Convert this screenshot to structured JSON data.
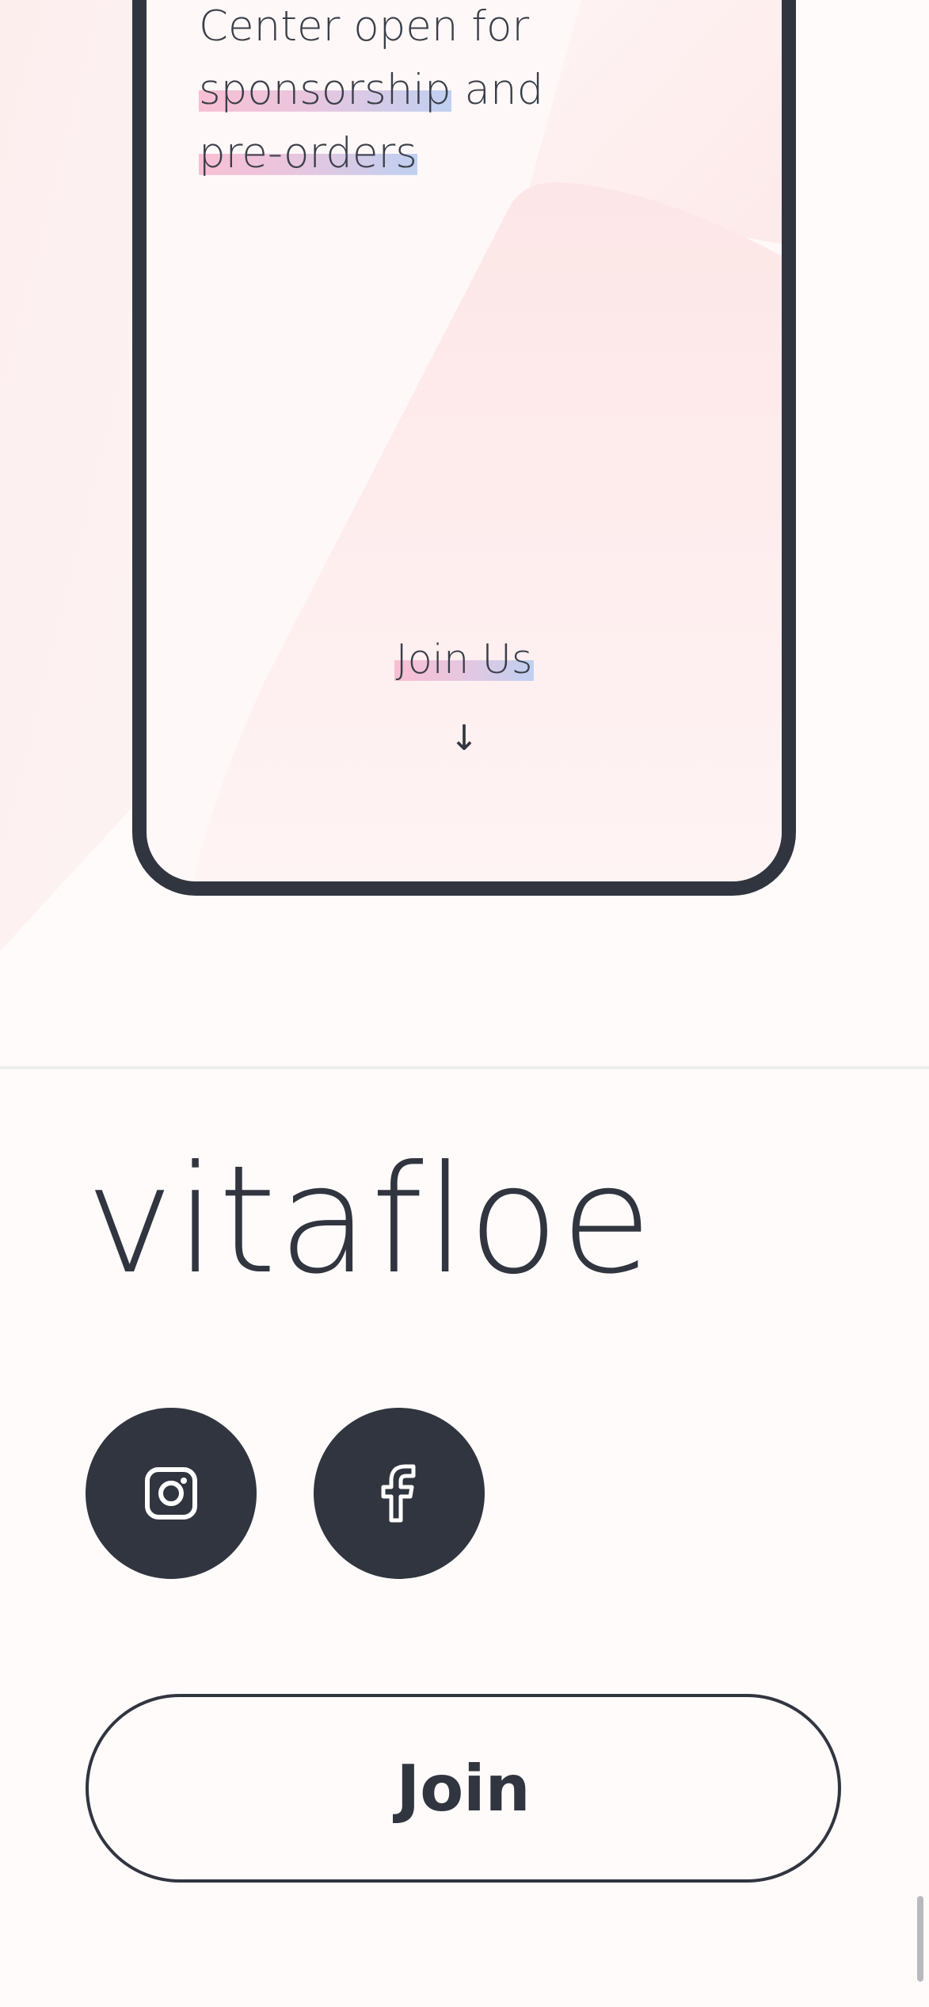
{
  "hero": {
    "text_line1": "Center open for",
    "text_line2_highlight": "sponsorship",
    "text_line2_rest": " and",
    "text_line3_highlight": "pre-orders",
    "join_us_label": "Join Us",
    "arrow_icon": "arrow-down-icon",
    "arrow_glyph": "↓"
  },
  "footer": {
    "logo_text": "vitafloe",
    "social_links": [
      {
        "name": "instagram",
        "icon": "instagram-icon"
      },
      {
        "name": "facebook",
        "icon": "facebook-icon"
      }
    ],
    "join_button_label": "Join"
  },
  "colors": {
    "dark": "#31353f",
    "page_background": "#fffbfb",
    "highlight_pink": "#f9bfd3",
    "highlight_blue": "#bfd0f1",
    "shape_pink": "#fde3e4",
    "divider": "#eeeeef"
  }
}
